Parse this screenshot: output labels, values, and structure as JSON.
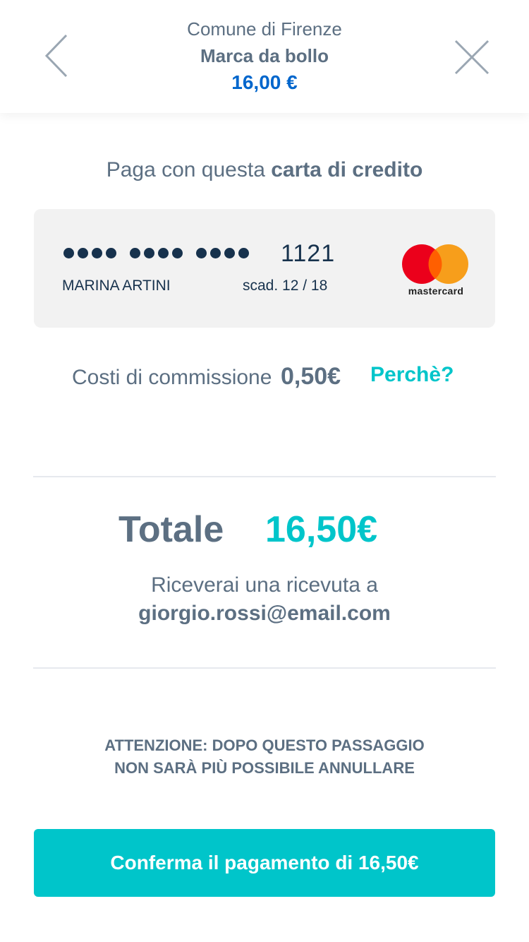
{
  "header": {
    "issuer": "Comune di Firenze",
    "item": "Marca da bollo",
    "amount": "16,00 €",
    "back_icon": "chevron-left-icon",
    "close_icon": "close-icon"
  },
  "payment": {
    "title_prefix": "Paga con questa ",
    "title_bold": "carta di credito"
  },
  "card": {
    "masked_groups": [
      "••••",
      "••••",
      "••••"
    ],
    "last4": "1121",
    "holder": "MARINA ARTINI",
    "expiry": "scad. 12 / 18",
    "brand": "mastercard",
    "brand_icon": "mastercard-logo-icon"
  },
  "fees": {
    "label": "Costi di commissione",
    "value": "0,50€",
    "why_link": "Perchè?"
  },
  "total": {
    "label": "Totale",
    "value": "16,50€",
    "receipt_text": "Riceverai una ricevuta a",
    "email": "giorgio.rossi@email.com"
  },
  "warning": {
    "line1": "ATTENZIONE: DOPO QUESTO PASSAGGIO",
    "line2": "NON SARÀ PIÙ POSSIBILE ANNULLARE"
  },
  "confirm_button": "Conferma il pagamento di 16,50€",
  "colors": {
    "accent": "#00c5ca",
    "link_blue": "#0066cc",
    "text": "#5c6f82",
    "card_text": "#17324d",
    "card_bg": "#f2f2f2"
  }
}
